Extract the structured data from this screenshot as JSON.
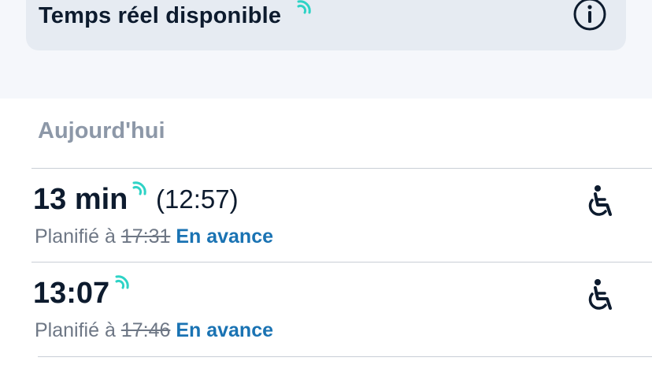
{
  "banner": {
    "title": "Temps réel disponible",
    "realtime_icon": "realtime-signal-icon",
    "info_icon": "info-icon"
  },
  "section": {
    "title": "Aujourd'hui"
  },
  "departures": [
    {
      "time": "13 min",
      "clock": "(12:57)",
      "planned_label": "Planifié à",
      "planned_time": "17:31",
      "status": "En avance",
      "accessibility_icon": "wheelchair-icon"
    },
    {
      "time": "13:07",
      "clock": "",
      "planned_label": "Planifié à",
      "planned_time": "17:46",
      "status": "En avance",
      "accessibility_icon": "wheelchair-icon"
    }
  ],
  "colors": {
    "realtime": "#2ed3c6",
    "status": "#1a73b3",
    "text": "#0d1b2e",
    "muted": "#6e7785",
    "banner_bg": "#e6ebf2"
  }
}
